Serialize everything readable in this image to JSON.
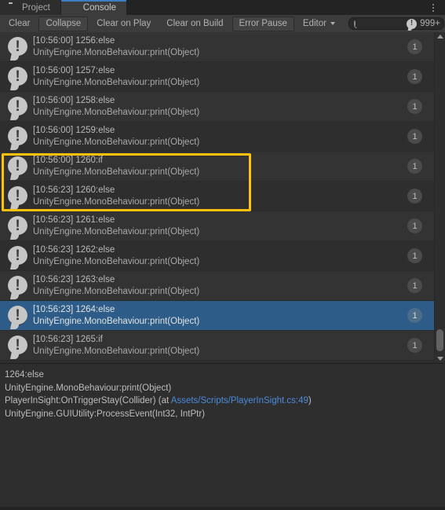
{
  "window": {
    "tabs": [
      {
        "label": "Project",
        "icon": "folder-icon",
        "active": false
      },
      {
        "label": "Console",
        "icon": "console-icon",
        "active": true
      }
    ],
    "menu_icon": "kebab-menu-icon"
  },
  "toolbar": {
    "clear_label": "Clear",
    "collapse_label": "Collapse",
    "clear_on_play_label": "Clear on Play",
    "clear_on_build_label": "Clear on Build",
    "error_pause_label": "Error Pause",
    "editor_label": "Editor",
    "editor_caret_icon": "chevron-down-icon",
    "search": {
      "value": "",
      "placeholder": "",
      "icon": "search-icon"
    },
    "error_count": {
      "value": "999+",
      "icon": "log-bubble-icon"
    }
  },
  "log": {
    "entries": [
      {
        "message": "[10:56:00] 1256:else",
        "stack": "UnityEngine.MonoBehaviour:print(Object)",
        "count": "1",
        "selected": false,
        "highlighted": false
      },
      {
        "message": "[10:56:00] 1257:else",
        "stack": "UnityEngine.MonoBehaviour:print(Object)",
        "count": "1",
        "selected": false,
        "highlighted": false
      },
      {
        "message": "[10:56:00] 1258:else",
        "stack": "UnityEngine.MonoBehaviour:print(Object)",
        "count": "1",
        "selected": false,
        "highlighted": false
      },
      {
        "message": "[10:56:00] 1259:else",
        "stack": "UnityEngine.MonoBehaviour:print(Object)",
        "count": "1",
        "selected": false,
        "highlighted": false
      },
      {
        "message": "[10:56:00] 1260:if",
        "stack": "UnityEngine.MonoBehaviour:print(Object)",
        "count": "1",
        "selected": false,
        "highlighted": true
      },
      {
        "message": "[10:56:23] 1260:else",
        "stack": "UnityEngine.MonoBehaviour:print(Object)",
        "count": "1",
        "selected": false,
        "highlighted": true
      },
      {
        "message": "[10:56:23] 1261:else",
        "stack": "UnityEngine.MonoBehaviour:print(Object)",
        "count": "1",
        "selected": false,
        "highlighted": false
      },
      {
        "message": "[10:56:23] 1262:else",
        "stack": "UnityEngine.MonoBehaviour:print(Object)",
        "count": "1",
        "selected": false,
        "highlighted": false
      },
      {
        "message": "[10:56:23] 1263:else",
        "stack": "UnityEngine.MonoBehaviour:print(Object)",
        "count": "1",
        "selected": false,
        "highlighted": false
      },
      {
        "message": "[10:56:23] 1264:else",
        "stack": "UnityEngine.MonoBehaviour:print(Object)",
        "count": "1",
        "selected": true,
        "highlighted": false
      },
      {
        "message": "[10:56:23] 1265:if",
        "stack": "UnityEngine.MonoBehaviour:print(Object)",
        "count": "1",
        "selected": false,
        "highlighted": false
      }
    ],
    "entry_icon": "log-bubble-icon"
  },
  "detail": {
    "lines": [
      {
        "text": "1264:else",
        "link": null,
        "suffix": null
      },
      {
        "text": "UnityEngine.MonoBehaviour:print(Object)",
        "link": null,
        "suffix": null
      },
      {
        "text": "PlayerInSight:OnTriggerStay(Collider) (at ",
        "link": "Assets/Scripts/PlayerInSight.cs:49",
        "suffix": ")"
      },
      {
        "text": "UnityEngine.GUIUtility:ProcessEvent(Int32, IntPtr)",
        "link": null,
        "suffix": null
      }
    ]
  },
  "colors": {
    "accent_tab": "#3b7ec1",
    "selection": "#2c5c87",
    "highlight": "#ffc20a",
    "link": "#4a8bdc"
  }
}
